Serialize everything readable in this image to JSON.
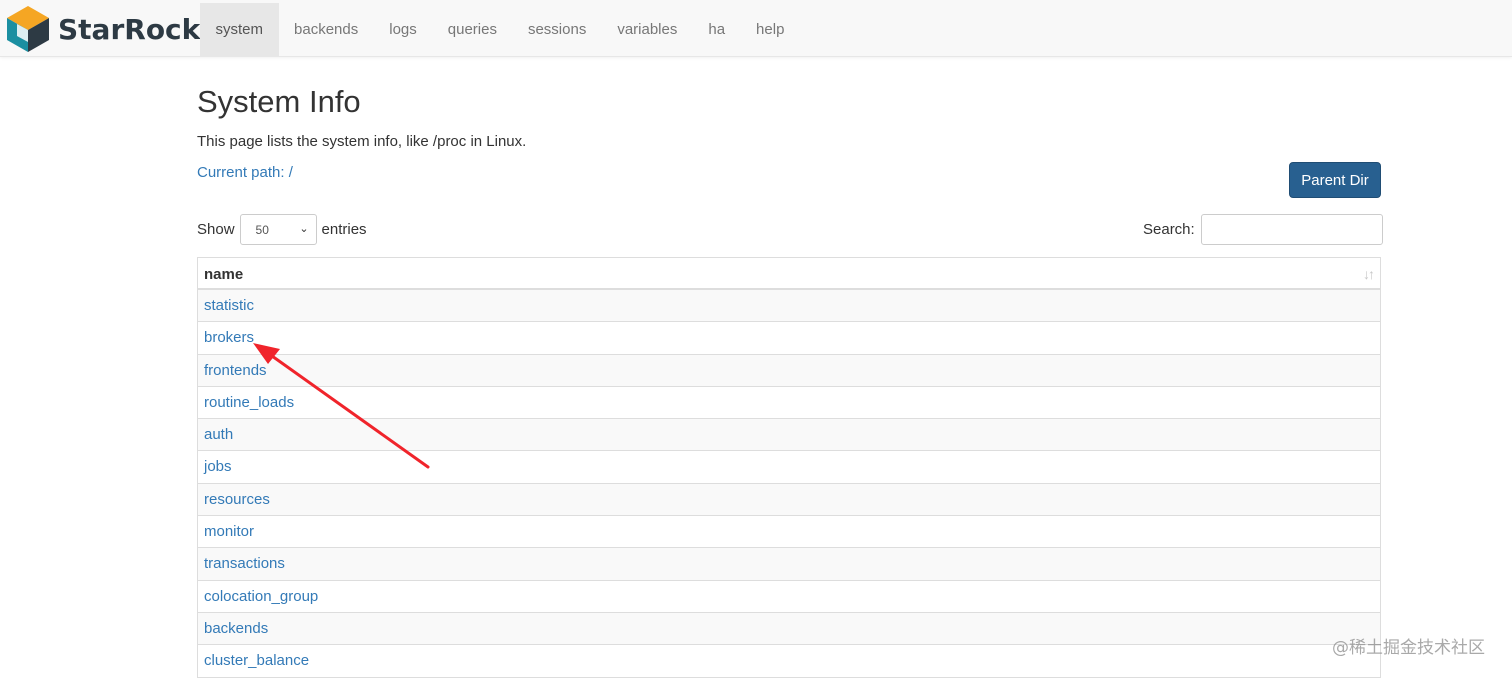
{
  "brand": {
    "name": "StarRocks",
    "logo": "starrocks-logo-icon",
    "colors": {
      "yellow": "#f5a623",
      "teal": "#1b8fa1",
      "dark": "#2d3a44"
    }
  },
  "nav": {
    "items": [
      {
        "label": "system",
        "active": true
      },
      {
        "label": "backends"
      },
      {
        "label": "logs"
      },
      {
        "label": "queries"
      },
      {
        "label": "sessions"
      },
      {
        "label": "variables"
      },
      {
        "label": "ha"
      },
      {
        "label": "help"
      }
    ]
  },
  "page": {
    "title": "System Info",
    "description": "This page lists the system info, like /proc in Linux.",
    "current_path": "Current path: /",
    "parent_button": "Parent Dir"
  },
  "controls": {
    "show_label": "Show",
    "entries_value": "50",
    "entries_label": "entries",
    "search_label": "Search:",
    "search_value": ""
  },
  "table": {
    "header": "name",
    "sort_icon": "sort-icon",
    "rows": [
      "statistic",
      "brokers",
      "frontends",
      "routine_loads",
      "auth",
      "jobs",
      "resources",
      "monitor",
      "transactions",
      "colocation_group",
      "backends",
      "cluster_balance"
    ]
  },
  "annotation": {
    "color": "#f0242b"
  },
  "watermark": "@稀土掘金技术社区"
}
